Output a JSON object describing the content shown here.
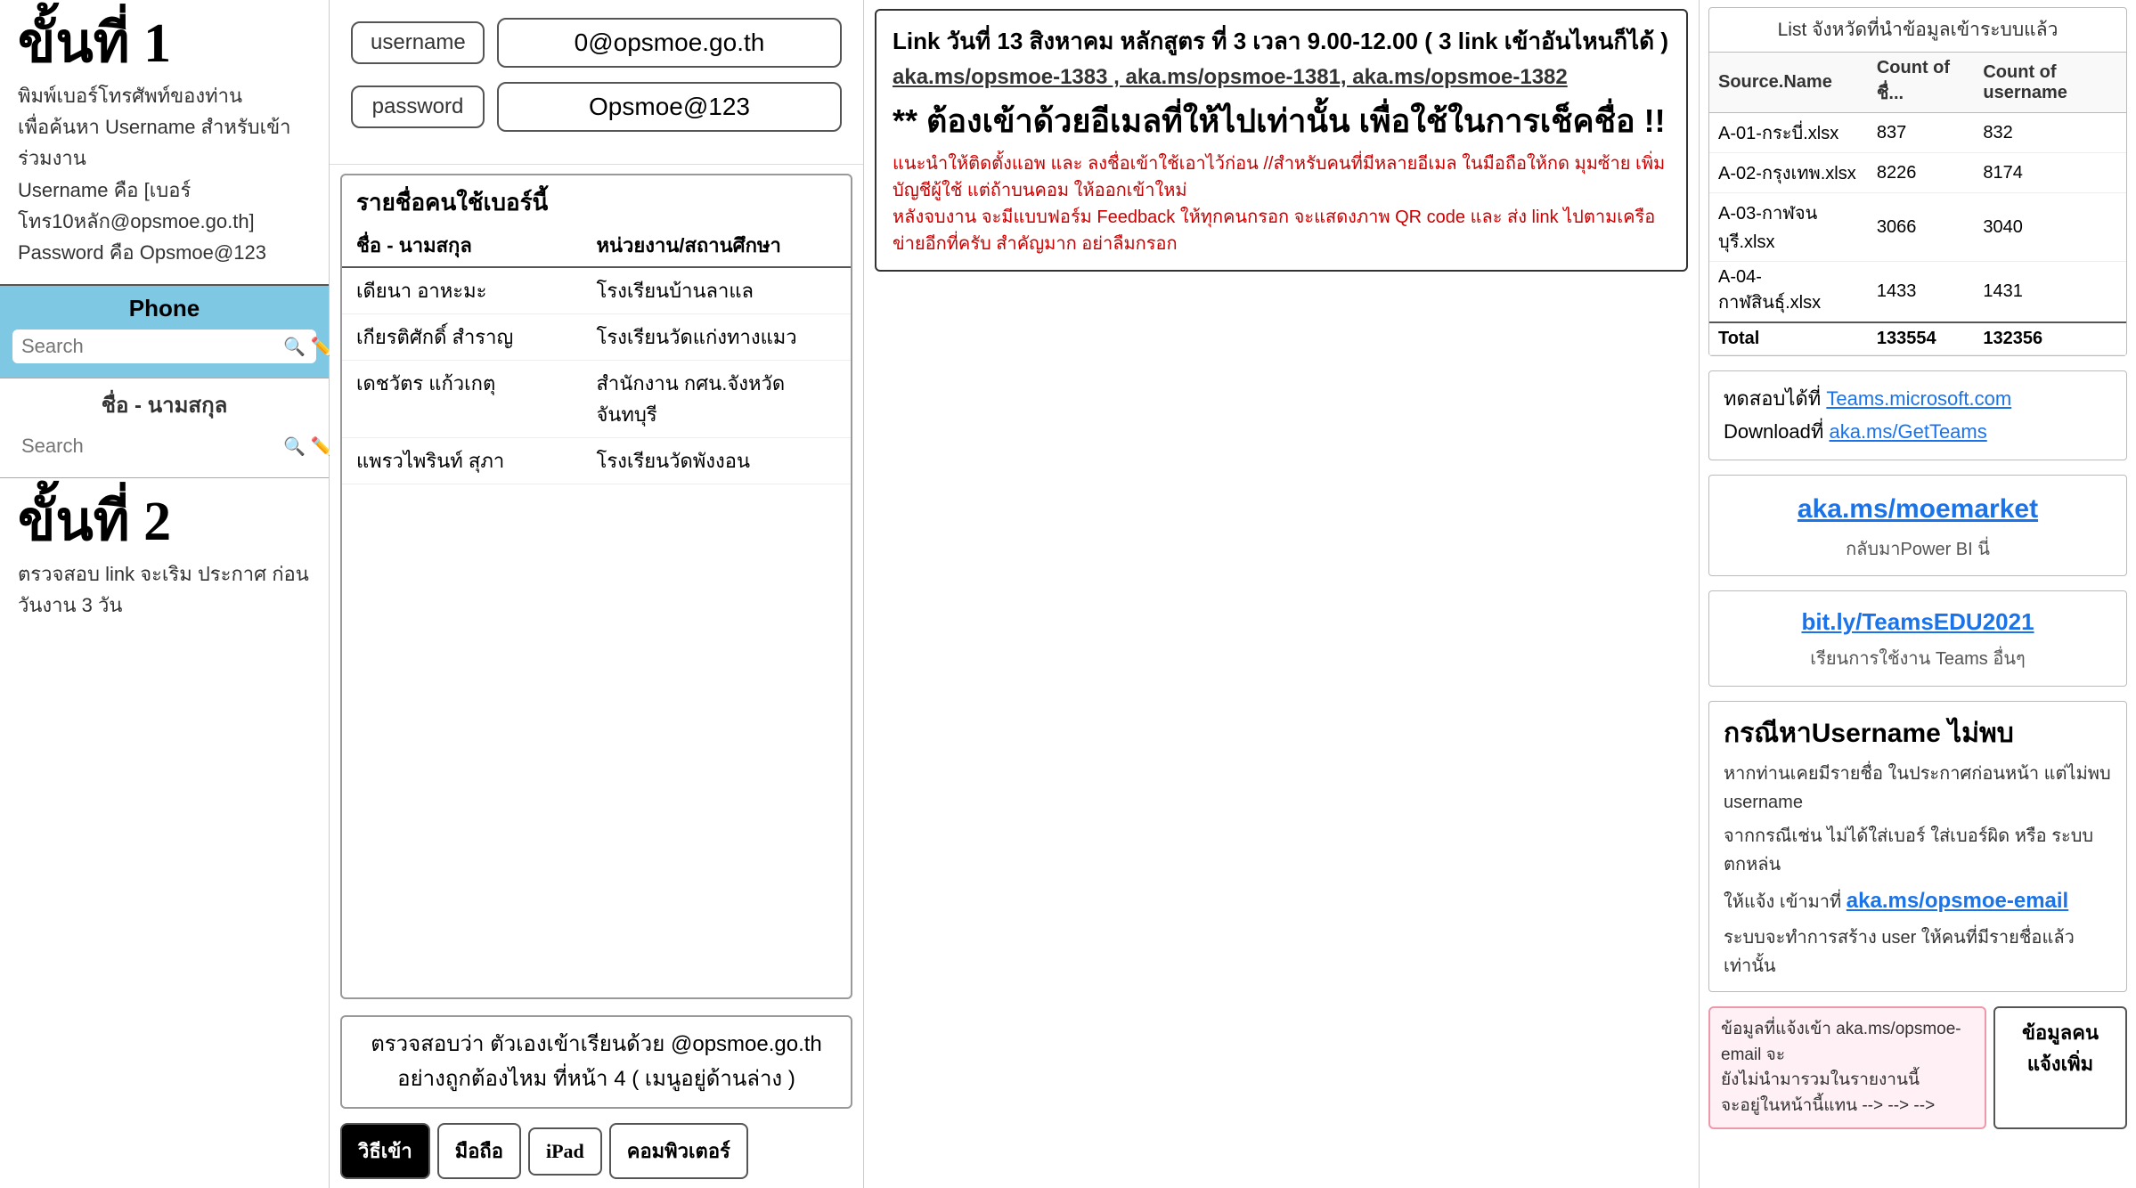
{
  "left": {
    "step1_title": "ขั้นที่ 1",
    "step1_desc": "พิมพ์เบอร์โทรศัพท์ของท่าน\nเพื่อค้นหา Username สำหรับเข้าร่วมงาน\nUsername คือ [เบอร์โทร10หลัก@opsmoe.go.th]\nPassword คือ Opsmoe@123",
    "phone_label": "Phone",
    "phone_search_placeholder": "Search",
    "name_label": "ชื่อ - นามสกุล",
    "name_search_placeholder": "Search",
    "step2_title": "ขั้นที่ 2",
    "step2_desc": "ตรวจสอบ link\nจะเริม ประกาศ ก่อนวันงาน 3 วัน"
  },
  "mid": {
    "username_label": "username",
    "username_value": "0@opsmoe.go.th",
    "password_label": "password",
    "password_value": "Opsmoe@123",
    "user_list_title": "รายชื่อคนใช้เบอร์นี้",
    "col1_header": "ชื่อ - นามสกุล",
    "col2_header": "หน่วยงาน/สถานศึกษา",
    "users": [
      {
        "name": "เดียนา อาหะมะ",
        "org": "โรงเรียนบ้านลาแล"
      },
      {
        "name": "เกียรติศักดิ์ สำราญ",
        "org": "โรงเรียนวัดแก่งทางแมว"
      },
      {
        "name": "เดชวัตร แก้วเกตุ",
        "org": "สำนักงาน กศน.จังหวัดจันทบุรี"
      },
      {
        "name": "แพรวไพรินท์ สุภา",
        "org": "โรงเรียนวัดพังงอน"
      }
    ],
    "check_text1": "ตรวจสอบว่า ตัวเองเข้าเรียนด้วย @opsmoe.go.th",
    "check_text2": "อย่างถูกต้องไหม ที่หน้า 4 ( เมนูอยู่ด้านล่าง )",
    "method_label": "วิธีเข้า",
    "method_mobile": "มือถือ",
    "method_ipad": "iPad",
    "method_computer": "คอมพิวเตอร์"
  },
  "main": {
    "ann_date": "Link วันที่ 13 สิงหาคม  หลักสูตร ที่ 3 เวลา 9.00-12.00 ( 3 link เข้าอันไหนก็ได้ )",
    "ann_links": "aka.ms/opsmoe-1383 , aka.ms/opsmoe-1381, aka.ms/opsmoe-1382",
    "ann_warning": "** ต้องเข้าด้วยอีเมลที่ให้ไปเท่านั้น เพื่อใช้ในการเช็คชื่อ !!",
    "ann_footer": "แนะนำให้ติดตั้งแอพ และ ลงชื่อเข้าใช้เอาไว้ก่อน //สำหรับคนที่มีหลายอีเมล ในมือถือให้กด มุมซ้าย เพิ่มบัญชีผู้ใช้ แต่ถ้าบนคอม ให้ออกเข้าใหม่\nหลังจบงาน จะมีแบบฟอร์ม Feedback ให้ทุกคนกรอก จะแสดงภาพ QR code และ ส่ง link ไปตามเครือข่ายอีกที่ครับ สำคัญมาก อย่าลืมกรอก"
  },
  "right": {
    "table_title": "List จังหวัดที่นำข้อมูลเข้าระบบแล้ว",
    "col_source": "Source.Name",
    "col_count_id": "Count of ชื่...",
    "col_count_username": "Count of username",
    "rows": [
      {
        "source": "A-01-กระบี่.xlsx",
        "count_id": "837",
        "count_user": "832"
      },
      {
        "source": "A-02-กรุงเทพ.xlsx",
        "count_id": "8226",
        "count_user": "8174"
      },
      {
        "source": "A-03-กาฬจนบุรี.xlsx",
        "count_id": "3066",
        "count_user": "3040"
      },
      {
        "source": "A-04-กาฬสินธุ์.xlsx",
        "count_id": "1433",
        "count_user": "1431"
      }
    ],
    "total_label": "Total",
    "total_count_id": "133554",
    "total_count_username": "132356",
    "test_label": "ทดสอบได้ที่",
    "test_link": "Teams.microsoft.com",
    "download_label": "Downloadที่",
    "download_link": "aka.ms/GetTeams",
    "powerbi_link": "aka.ms/moemarket",
    "powerbi_sub": "กลับมาPower BI  นี่",
    "teams_edu_link": "bit.ly/TeamsEDU2021",
    "teams_edu_sub": "เรียนการใช้งาน Teams อื่นๆ",
    "not_found_title": "กรณีหาUsername ไม่พบ",
    "not_found_desc1": "หากท่านเคยมีรายชื่อ ในประกาศก่อนหน้า แต่ไม่พบ username",
    "not_found_desc2": "จากกรณีเช่น ไม่ได้ใส่เบอร์ ใส่เบอร์ผิด หรือ ระบบตกหล่น",
    "not_found_desc3": "ให้แจ้ง เข้ามาที่",
    "not_found_link": "aka.ms/opsmoe-email",
    "not_found_desc4": "ระบบจะทำการสร้าง user ให้คนที่มีรายชื่อแล้วเท่านั้น",
    "data_note": "ข้อมูลที่แจ้งเข้า aka.ms/opsmoe-email จะ\nยังไม่นำมารวมในรายงานนี้\nจะอยู่ในหน้านี้แทน --> --> -->",
    "add_data_btn": "ข้อมูลคนแจ้งเพิ่ม"
  }
}
